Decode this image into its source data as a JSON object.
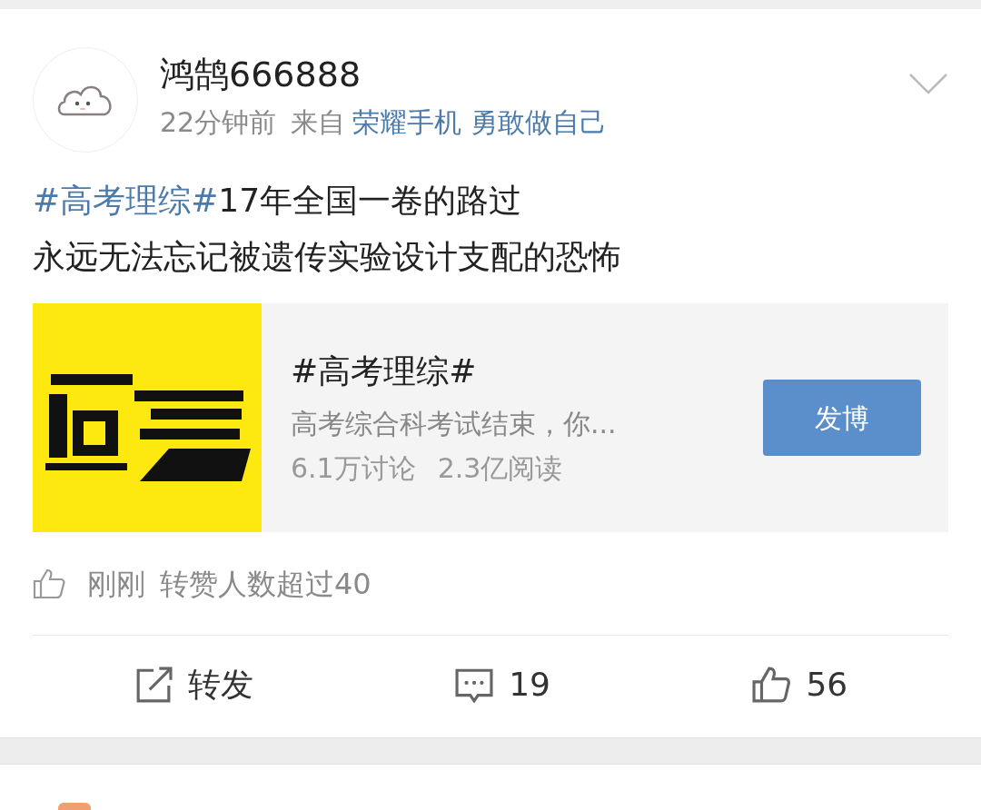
{
  "post": {
    "author": "鸿鹄666888",
    "time": "22分钟前",
    "source_prefix": "来自",
    "source": "荣耀手机 勇敢做自己",
    "text_lines": [
      {
        "topic": "#高考理综#",
        "text": "17年全国一卷的路过"
      },
      {
        "text": "永远无法忘记被遗传实验设计支配的恐怖"
      }
    ],
    "topic_card": {
      "title": "#高考理综#",
      "description": "高考综合科考试结束，你...",
      "discussions": "6.1万讨论",
      "reads": "2.3亿阅读",
      "button": "发博"
    },
    "like_notice": {
      "time": "刚刚",
      "text": "转赞人数超过40"
    },
    "actions": [
      {
        "kind": "repost",
        "label": "转发"
      },
      {
        "kind": "comment",
        "label": "19"
      },
      {
        "kind": "like",
        "label": "56"
      }
    ]
  }
}
